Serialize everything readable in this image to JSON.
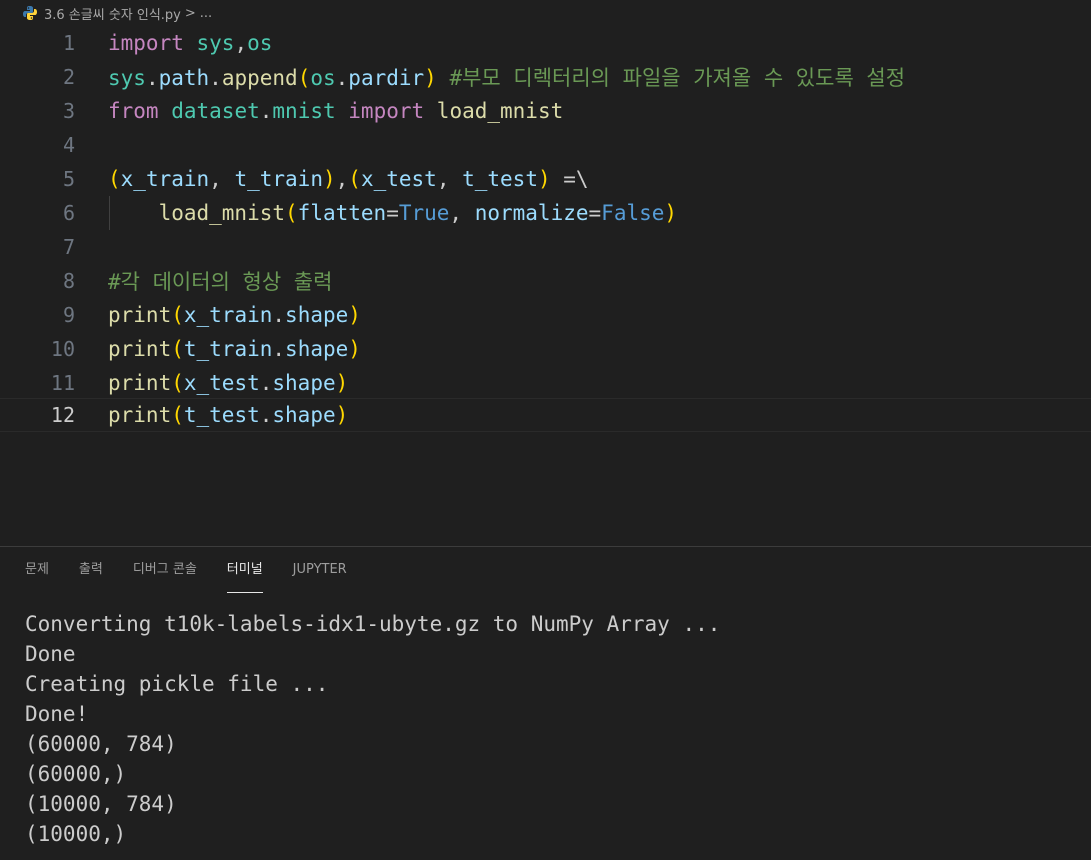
{
  "breadcrumb": {
    "file": "3.6 손글씨 숫자 인식.py",
    "separator": ">",
    "more": "..."
  },
  "editor": {
    "line_numbers": [
      "1",
      "2",
      "3",
      "4",
      "5",
      "6",
      "7",
      "8",
      "9",
      "10",
      "11",
      "12"
    ],
    "active_line": "12",
    "code": {
      "l1": [
        "import",
        " ",
        "sys",
        ",",
        "os"
      ],
      "l2": [
        "sys",
        ".",
        "path",
        ".",
        "append",
        "(",
        "os",
        ".",
        "pardir",
        ")",
        " ",
        "#부모 디렉터리의 파일을 가져올 수 있도록 설정"
      ],
      "l3": [
        "from",
        " ",
        "dataset",
        ".",
        "mnist",
        " ",
        "import",
        " ",
        "load_mnist"
      ],
      "l5": [
        "(",
        "x_train",
        ", ",
        "t_train",
        ")",
        ",",
        "(",
        "x_test",
        ", ",
        "t_test",
        ")",
        " =\\"
      ],
      "l6": [
        "    ",
        "load_mnist",
        "(",
        "flatten",
        "=",
        "True",
        ", ",
        "normalize",
        "=",
        "False",
        ")"
      ],
      "l8": [
        "#각 데이터의 형상 출력"
      ],
      "l9": [
        "print",
        "(",
        "x_train",
        ".",
        "shape",
        ")"
      ],
      "l10": [
        "print",
        "(",
        "t_train",
        ".",
        "shape",
        ")"
      ],
      "l11": [
        "print",
        "(",
        "x_test",
        ".",
        "shape",
        ")"
      ],
      "l12": [
        "print",
        "(",
        "t_test",
        ".",
        "shape",
        ")"
      ]
    }
  },
  "panel": {
    "tabs": [
      "문제",
      "출력",
      "디버그 콘솔",
      "터미널",
      "JUPYTER"
    ],
    "active_tab": "터미널",
    "terminal_lines": [
      "Converting t10k-labels-idx1-ubyte.gz to NumPy Array ...",
      "Done",
      "Creating pickle file ...",
      "Done!",
      "(60000, 784)",
      "(60000,)",
      "(10000, 784)",
      "(10000,)"
    ]
  },
  "colors": {
    "background": "#1f1f1f",
    "keyword": "#c586c0",
    "variable": "#9cdcfe",
    "function": "#dcdcaa",
    "module": "#4ec9b0",
    "constant": "#569cd6",
    "comment": "#6a9955",
    "bracket_level1": "#ffd700",
    "bracket_level2": "#da70d6"
  },
  "icons": {
    "file_icon": "python-icon"
  }
}
